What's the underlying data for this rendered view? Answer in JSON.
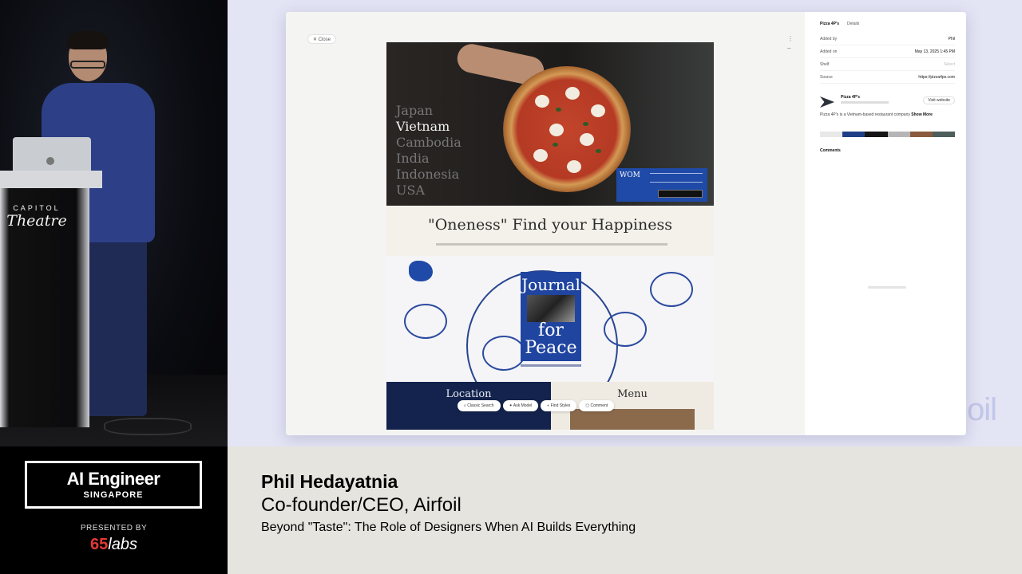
{
  "speaker_video": {
    "podium_sign_top": "CAPITOL",
    "podium_sign_bottom": "Theatre"
  },
  "slide": {
    "corner_logo": "oil",
    "app": {
      "close_label": "Close",
      "website": {
        "countries": [
          "Japan",
          "Vietnam",
          "Cambodia",
          "India",
          "Indonesia",
          "USA"
        ],
        "active_country": "Vietnam",
        "hero_card_title": "WOM",
        "tagline": "\"Oneness\" Find your Happiness",
        "journal_top": "Journal",
        "journal_bottom_1": "for",
        "journal_bottom_2": "Peace",
        "footer_location": "Location",
        "footer_menu": "Menu",
        "actions": [
          "Classic Search",
          "Ask Model",
          "Find Styles",
          "Comment"
        ]
      },
      "side_panel": {
        "tabs": [
          "Pizza 4P's",
          "Details"
        ],
        "rows": [
          {
            "label": "Added by",
            "value": "Phil"
          },
          {
            "label": "Added on",
            "value": "May 13, 2025 1:45 PM"
          },
          {
            "label": "Shelf",
            "value": "Select"
          },
          {
            "label": "Source",
            "value": "https://pizza4ps.com"
          }
        ],
        "brand": {
          "name": "Pizza 4P's",
          "button": "Visit website",
          "description": "Pizza 4P's is a Vietnam-based restaurant company",
          "show_more": "Show More"
        },
        "swatches": [
          "#e8e8e8",
          "#1e3f87",
          "#151515",
          "#b5b5b5",
          "#8a5a3c",
          "#4e5e5a"
        ],
        "comments_label": "Comments"
      }
    }
  },
  "lower_third": {
    "event_name": "AI Engineer",
    "event_location": "SINGAPORE",
    "presented_by": "PRESENTED BY",
    "sponsor_number": "65",
    "sponsor_word": "labs",
    "speaker_name": "Phil Hedayatnia",
    "speaker_role": "Co-founder/CEO, Airfoil",
    "talk_title": "Beyond \"Taste\": The Role of Designers When AI Builds Everything"
  }
}
